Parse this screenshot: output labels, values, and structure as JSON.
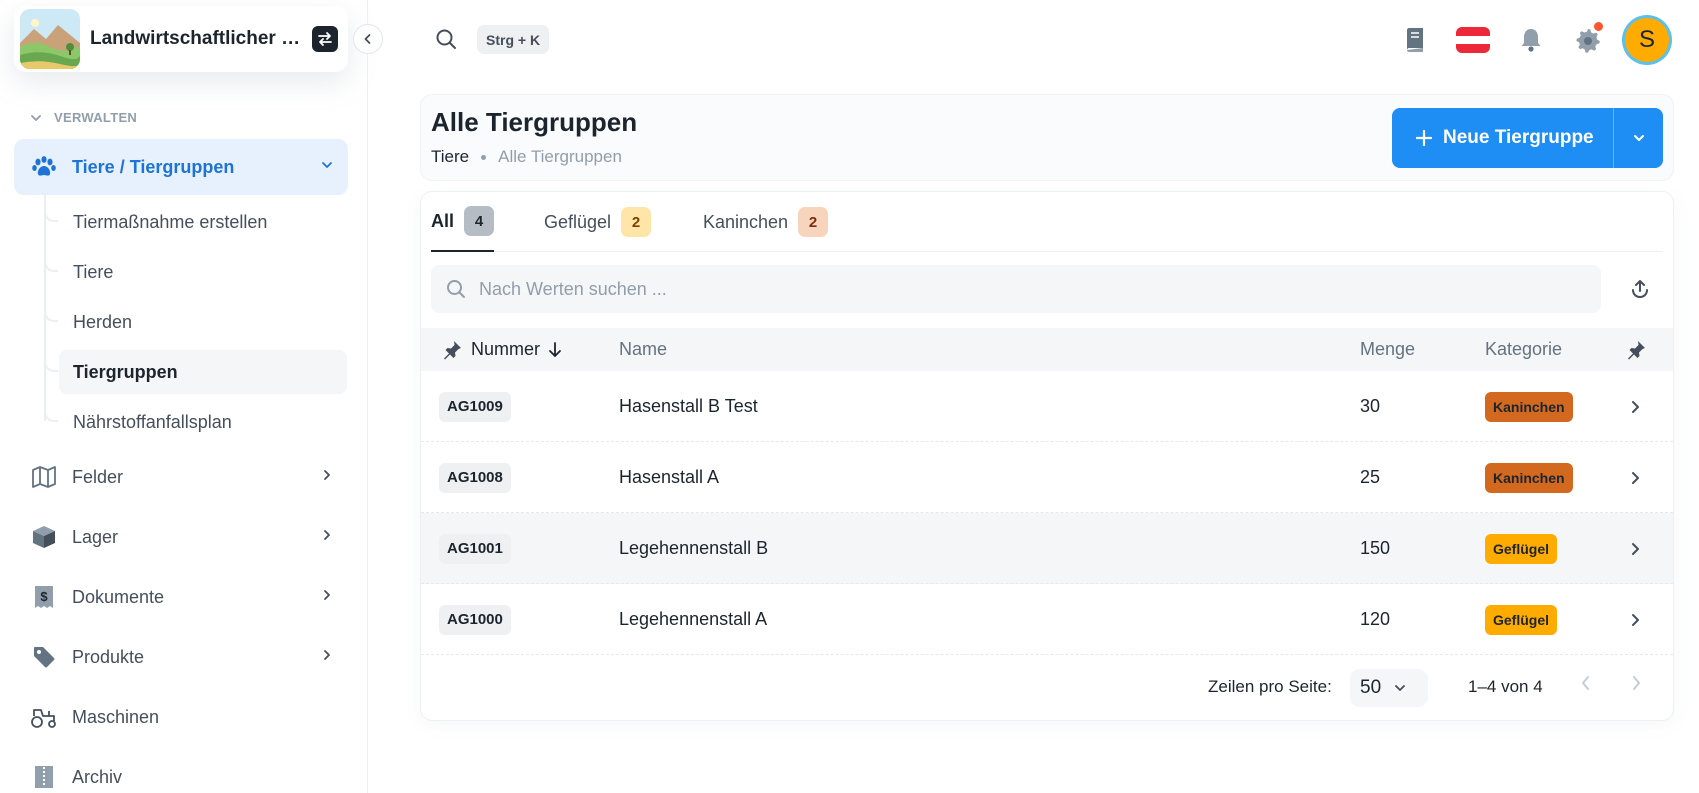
{
  "org": {
    "name": "Landwirtschaftlicher Betrieb"
  },
  "sidebar": {
    "section_label": "VERWALTEN",
    "active_group": "Tiere / Tiergruppen",
    "sub_items": [
      "Tiermaßnahme erstellen",
      "Tiere",
      "Herden",
      "Tiergruppen",
      "Nährstoffanfallsplan"
    ],
    "active_sub_item": "Tiergruppen",
    "items": [
      {
        "label": "Felder",
        "icon": "map-icon",
        "has_children": true
      },
      {
        "label": "Lager",
        "icon": "box-icon",
        "has_children": true
      },
      {
        "label": "Dokumente",
        "icon": "invoice-icon",
        "has_children": true
      },
      {
        "label": "Produkte",
        "icon": "tag-icon",
        "has_children": true
      },
      {
        "label": "Maschinen",
        "icon": "tractor-icon",
        "has_children": false
      },
      {
        "label": "Archiv",
        "icon": "archive-icon",
        "has_children": false
      }
    ]
  },
  "topbar": {
    "search_shortcut": "Strg + K",
    "avatar_initial": "S",
    "has_notification": true
  },
  "header": {
    "title": "Alle Tiergruppen",
    "breadcrumb": [
      "Tiere",
      "Alle Tiergruppen"
    ],
    "new_button_label": "Neue Tiergruppe"
  },
  "tabs": [
    {
      "label": "All",
      "count": "4",
      "active": true
    },
    {
      "label": "Geflügel",
      "count": "2",
      "active": false
    },
    {
      "label": "Kaninchen",
      "count": "2",
      "active": false
    }
  ],
  "search": {
    "placeholder": "Nach Werten suchen ..."
  },
  "table": {
    "columns": [
      "Nummer",
      "Name",
      "Menge",
      "Kategorie"
    ],
    "sort_column": "Nummer",
    "sort_direction": "descending",
    "rows": [
      {
        "nummer": "AG1009",
        "name": "Hasenstall B Test",
        "menge": "30",
        "kategorie": "Kaninchen"
      },
      {
        "nummer": "AG1008",
        "name": "Hasenstall A",
        "menge": "25",
        "kategorie": "Kaninchen"
      },
      {
        "nummer": "AG1001",
        "name": "Legehennenstall B",
        "menge": "150",
        "kategorie": "Geflügel"
      },
      {
        "nummer": "AG1000",
        "name": "Legehennenstall A",
        "menge": "120",
        "kategorie": "Geflügel"
      }
    ]
  },
  "pagination": {
    "rows_per_page_label": "Zeilen pro Seite:",
    "rows_per_page": "50",
    "range": "1–4 von 4"
  },
  "colors": {
    "primary": "#1e8df4",
    "nav_active_text": "#1e74d6",
    "nav_active_bg": "#e6f1fd",
    "kaninchen": "#d2691e",
    "gefluegel": "#ffab00",
    "avatar": "#ffab00"
  }
}
